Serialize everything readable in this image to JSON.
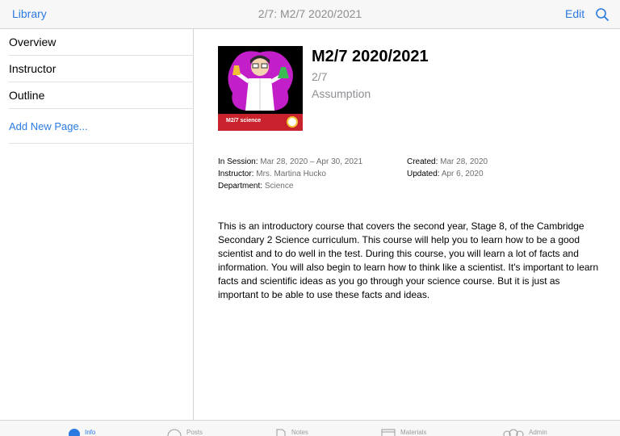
{
  "navbar": {
    "back_label": "Library",
    "title": "2/7: M2/7 2020/2021",
    "edit_label": "Edit",
    "search_icon": "search-icon",
    "accent": "#2a7ae2"
  },
  "sidebar": {
    "items": [
      {
        "label": "Overview"
      },
      {
        "label": "Instructor"
      },
      {
        "label": "Outline"
      }
    ],
    "add_label": "Add New Page..."
  },
  "course": {
    "cover_caption": "M2/7 science",
    "title": "M2/7 2020/2021",
    "section": "2/7",
    "school": "Assumption",
    "session_label": "In Session:",
    "session_value": "Mar 28, 2020 – Apr 30, 2021",
    "instructor_label": "Instructor:",
    "instructor_value": "Mrs. Martina Hucko",
    "department_label": "Department:",
    "department_value": "Science",
    "created_label": "Created:",
    "created_value": "Mar 28, 2020",
    "updated_label": "Updated:",
    "updated_value": "Apr 6, 2020",
    "description": "This is an introductory course that covers the second year, Stage 8, of the Cambridge Secondary 2 Science curriculum. This course will help you to learn how to be a good scientist and to do well in the test. During this course, you will learn a lot of facts and information. You will also begin to learn how to think like a scientist. It's important to learn facts and scientific ideas as you go through your science course. But it is just as important to be able to use these facts and ideas."
  },
  "tabs": [
    {
      "label": "Info",
      "icon": "info-icon",
      "active": true
    },
    {
      "label": "Posts",
      "icon": "posts-icon",
      "active": false
    },
    {
      "label": "Notes",
      "icon": "notes-icon",
      "active": false
    },
    {
      "label": "Materials",
      "icon": "materials-icon",
      "active": false
    },
    {
      "label": "Admin",
      "icon": "admin-icon",
      "active": false
    }
  ]
}
